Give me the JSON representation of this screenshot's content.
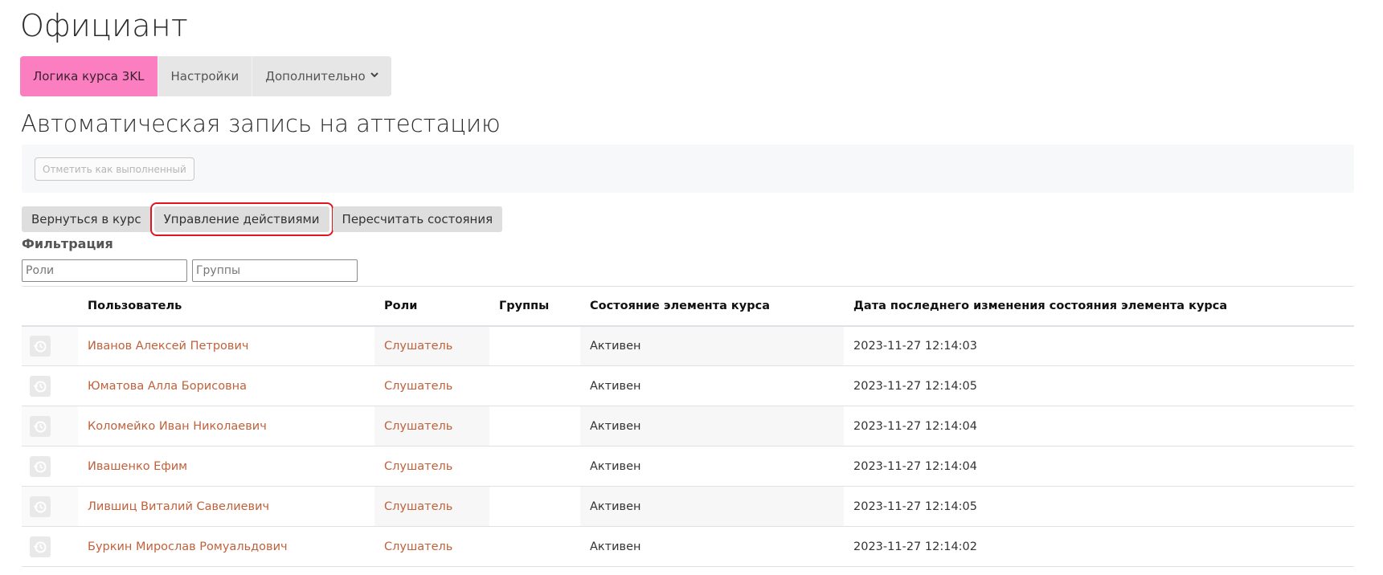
{
  "page": {
    "title": "Официант"
  },
  "nav": {
    "tabs": [
      {
        "label": "Логика курса 3KL"
      },
      {
        "label": "Настройки"
      },
      {
        "label": "Дополнительно"
      }
    ]
  },
  "section": {
    "title": "Автоматическая запись на аттестацию",
    "mark_done_label": "Отметить как выполненный"
  },
  "actions": {
    "back_label": "Вернуться в курс",
    "manage_label": "Управление действиями",
    "recalc_label": "Пересчитать состояния"
  },
  "filter": {
    "label": "Фильтрация",
    "roles_placeholder": "Роли",
    "groups_placeholder": "Группы"
  },
  "table": {
    "headers": {
      "user": "Пользователь",
      "roles": "Роли",
      "groups": "Группы",
      "state": "Состояние элемента курса",
      "date": "Дата последнего изменения состояния элемента курса"
    },
    "rows": [
      {
        "user": "Иванов Алексей Петрович",
        "role": "Слушатель",
        "groups": "",
        "state": "Активен",
        "date": "2023-11-27 12:14:03"
      },
      {
        "user": "Юматова Алла Борисовна",
        "role": "Слушатель",
        "groups": "",
        "state": "Активен",
        "date": "2023-11-27 12:14:05"
      },
      {
        "user": "Коломейко Иван Николаевич",
        "role": "Слушатель",
        "groups": "",
        "state": "Активен",
        "date": "2023-11-27 12:14:04"
      },
      {
        "user": "Ивашенко Ефим",
        "role": "Слушатель",
        "groups": "",
        "state": "Активен",
        "date": "2023-11-27 12:14:04"
      },
      {
        "user": "Лившиц Виталий Савелиевич",
        "role": "Слушатель",
        "groups": "",
        "state": "Активен",
        "date": "2023-11-27 12:14:05"
      },
      {
        "user": "Буркин Мирослав Ромуальдович",
        "role": "Слушатель",
        "groups": "",
        "state": "Активен",
        "date": "2023-11-27 12:14:02"
      }
    ]
  },
  "colors": {
    "active_tab": "#fb7fc0",
    "link": "#c0613b",
    "highlight_border": "#e0161e"
  },
  "icons": {
    "row_action": "history-icon",
    "dropdown": "chevron-down-icon"
  }
}
